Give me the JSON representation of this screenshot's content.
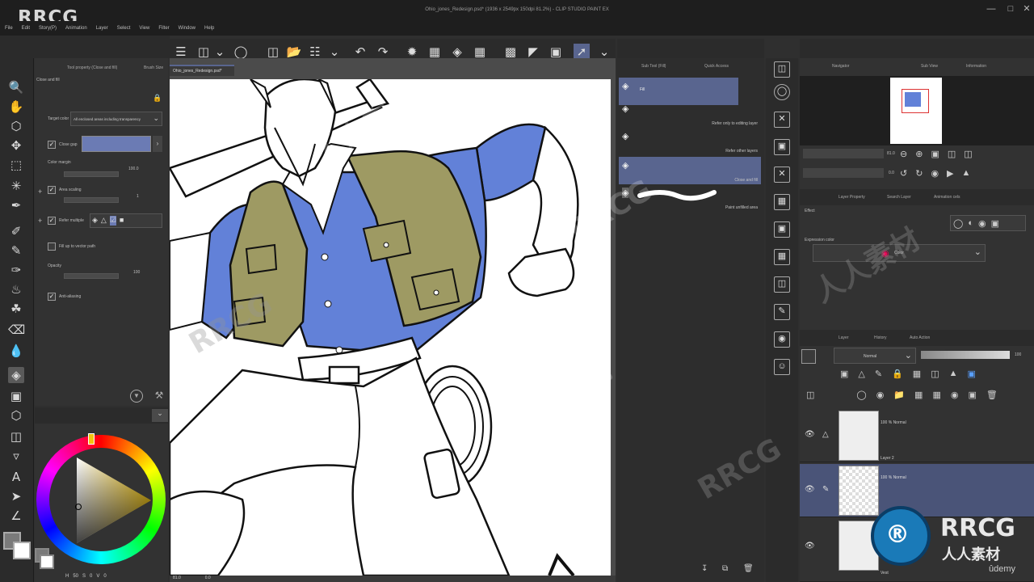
{
  "app": {
    "logo": "RRCG",
    "window_title": "Ohio_jones_Redesign.psd* (1936 x 2549px 150dpi 81.2%) - CLIP STUDIO PAINT EX"
  },
  "menu": [
    "File",
    "Edit",
    "Story(P)",
    "Animation",
    "Layer",
    "Select",
    "View",
    "Filter",
    "Window",
    "Help"
  ],
  "tool_property": {
    "tab_label": "Tool property (Close and fill)",
    "tab2_label": "Brush Size",
    "tool_name": "Close and fill",
    "target_color_label": "Target color",
    "target_color_value": "All enclosed areas including transparency",
    "close_gap_label": "Close gap",
    "color_margin_label": "Color margin",
    "color_margin_value": "100.0",
    "area_scaling_label": "Area scaling",
    "area_scaling_value": "1",
    "refer_multiple_label": "Refer multiple",
    "fill_vector_label": "Fill up to vector path",
    "opacity_label": "Opacity",
    "opacity_value": "100",
    "antialiasing_label": "Anti-aliasing"
  },
  "canvas": {
    "tab_label": "Ohio_jones_Redesign.psd*",
    "status_zoom": "81.0",
    "status_angle": "0.0"
  },
  "sub_tool": {
    "tab_label": "Sub Tool (Fill)",
    "tab2_label": "Quick Access",
    "items": [
      {
        "name": "Fill"
      },
      {
        "name": "Refer only to editing layer"
      },
      {
        "name": "Refer other layers"
      },
      {
        "name": "Close and fill"
      },
      {
        "name": "Paint unfilled area"
      }
    ]
  },
  "navigator": {
    "tab_label": "Navigator",
    "tab2_label": "Sub View",
    "tab3_label": "Information",
    "zoom": "81.0",
    "angle": "0.0"
  },
  "layer_property": {
    "tab_label": "Layer Property",
    "tab2_label": "Search Layer",
    "tab3_label": "Animation cels",
    "effect_label": "Effect",
    "expression_label": "Expression color",
    "expression_value": "Color"
  },
  "layers": {
    "tab_label": "Layer",
    "tab2_label": "History",
    "tab3_label": "Auto Action",
    "blend_mode": "Normal",
    "opacity": "100",
    "rows": [
      {
        "blend": "100 % Normal",
        "name": "Layer 2"
      },
      {
        "blend": "100 % Normal",
        "name": ""
      },
      {
        "blend": "",
        "name": "Vest"
      }
    ]
  },
  "color_wheel": {
    "h": "H",
    "h_val": "50",
    "s": "S",
    "s_val": "0",
    "v": "V",
    "v_val": "0",
    "main_color": "#7a7a7a",
    "sub_color": "#ffffff"
  },
  "watermark": {
    "brand": "RRCG",
    "cn": "人人素材",
    "udemy": "ûdemy"
  },
  "colors": {
    "shirt": "#6281d8",
    "vest": "#9e9a63",
    "accent": "#59658f"
  }
}
